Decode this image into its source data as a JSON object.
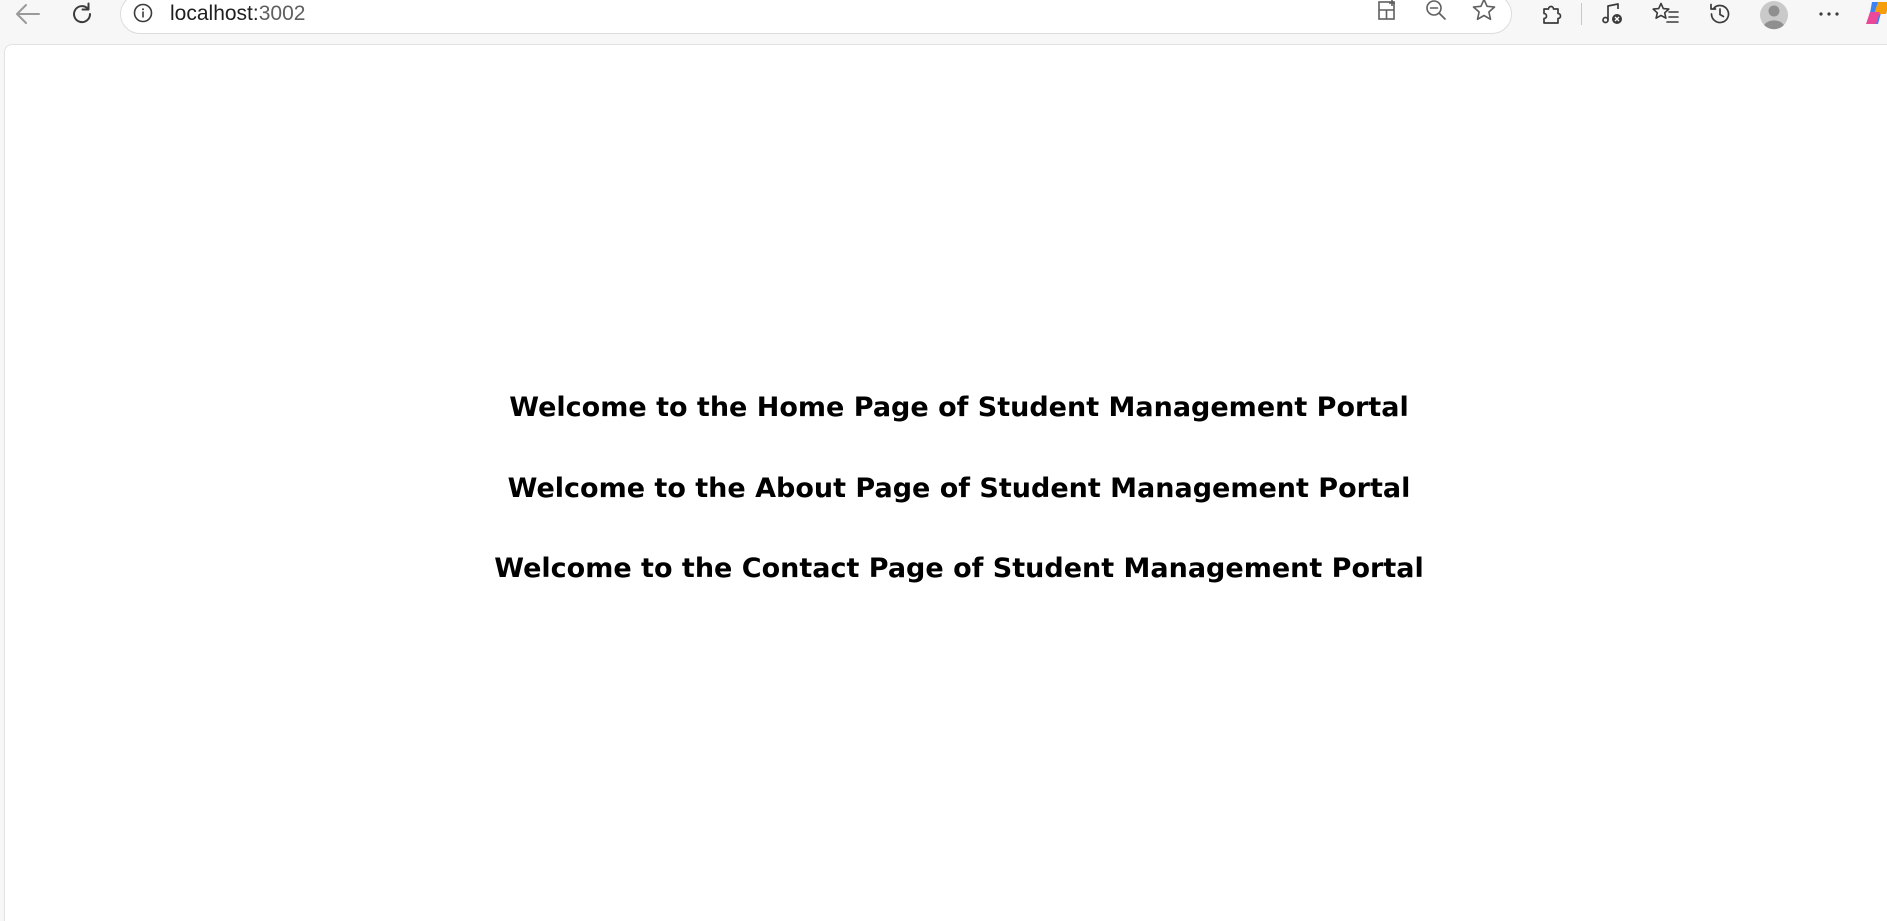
{
  "browser": {
    "url_host": "localhost:",
    "url_port": "3002",
    "icons": {
      "back": "back-arrow-icon",
      "reload": "reload-icon",
      "info": "info-icon",
      "app_available": "app-available-icon",
      "zoom_out": "zoom-out-icon",
      "favorite": "star-icon",
      "extensions": "puzzle-icon",
      "media": "media-control-icon",
      "favorites": "favorites-list-icon",
      "history": "history-icon",
      "profile": "avatar-icon",
      "menu": "more-icon"
    }
  },
  "page": {
    "headings": [
      "Welcome to the Home Page of Student Management Portal",
      "Welcome to the About Page of Student Management Portal",
      "Welcome to the Contact Page of Student Management Portal"
    ]
  },
  "colors": {
    "toolbar_bg": "#f7f7f7",
    "page_bg": "#ffffff",
    "text": "#000000",
    "icon": "#5f5f5f"
  }
}
